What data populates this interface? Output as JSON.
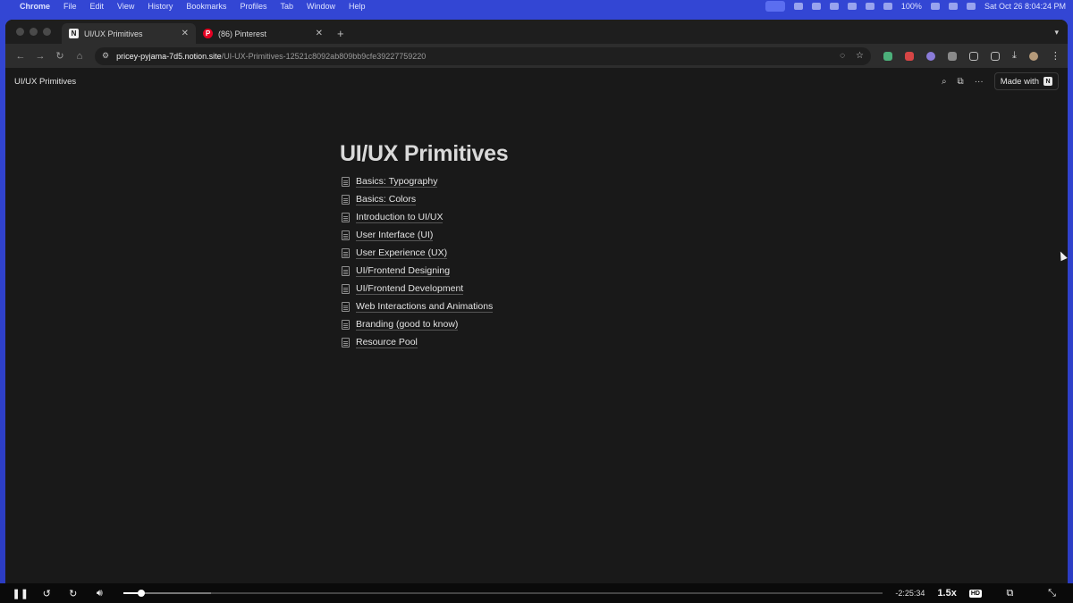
{
  "menubar": {
    "app": "Chrome",
    "items": [
      "File",
      "Edit",
      "View",
      "History",
      "Bookmarks",
      "Profiles",
      "Tab",
      "Window",
      "Help"
    ],
    "battery": "100%",
    "datetime": "Sat Oct 26  8:04:24 PM"
  },
  "tabs": [
    {
      "title": "UI/UX Primitives",
      "favicon": "N",
      "active": true
    },
    {
      "title": "(86) Pinterest",
      "favicon": "P",
      "active": false
    }
  ],
  "toolbar": {
    "url_host": "pricey-pyjama-7d5.notion.site",
    "url_path": "/UI-UX-Primitives-12521c8092ab809bb9cfe39227759220"
  },
  "notion": {
    "breadcrumb": "UI/UX Primitives",
    "made_with": "Made with",
    "page_title": "UI/UX Primitives",
    "pages": [
      "Basics: Typography",
      "Basics: Colors",
      "Introduction to UI/UX",
      "User Interface (UI)",
      "User Experience (UX)",
      "UI/Frontend Designing",
      "UI/Frontend Development",
      "Web Interactions and Animations",
      "Branding (good to know)",
      "Resource Pool"
    ]
  },
  "player": {
    "time_remaining": "-2:25:34",
    "speed": "1.5x",
    "hd_badge": "HD",
    "played_fraction": 0.023,
    "buffered_fraction": 0.115
  }
}
